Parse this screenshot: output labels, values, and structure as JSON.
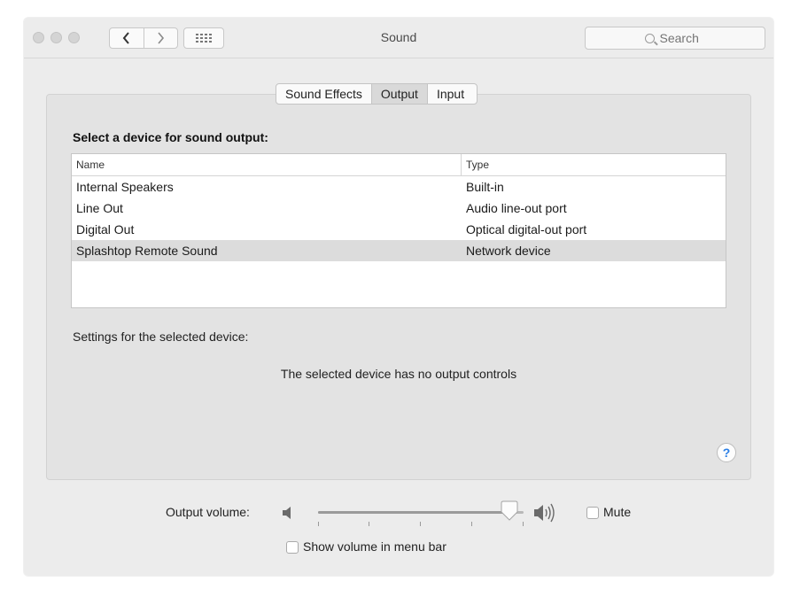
{
  "window": {
    "title": "Sound",
    "search_placeholder": "Search"
  },
  "toolbar": {
    "back_icon": "chevron-left-icon",
    "forward_icon": "chevron-right-icon",
    "show_all_icon": "grid-icon"
  },
  "tabs": [
    {
      "label": "Sound Effects",
      "active": false
    },
    {
      "label": "Output",
      "active": true
    },
    {
      "label": "Input",
      "active": false
    }
  ],
  "output": {
    "section_title": "Select a device for sound output:",
    "columns": [
      "Name",
      "Type"
    ],
    "devices": [
      {
        "name": "Internal Speakers",
        "type": "Built-in",
        "selected": false
      },
      {
        "name": "Line Out",
        "type": "Audio line-out port",
        "selected": false
      },
      {
        "name": "Digital Out",
        "type": "Optical digital-out port",
        "selected": false
      },
      {
        "name": "Splashtop Remote Sound",
        "type": "Network device",
        "selected": true
      }
    ],
    "settings_label": "Settings for the selected device:",
    "no_controls_text": "The selected device has no output controls"
  },
  "help": {
    "label": "?"
  },
  "volume": {
    "label": "Output volume:",
    "level": 0.93,
    "mute_label": "Mute",
    "mute_checked": false,
    "show_in_menu_bar_label": "Show volume in menu bar",
    "show_in_menu_bar_checked": false
  },
  "colors": {
    "accent": "#2b7fe6",
    "selected_row": "#dcdcdc"
  }
}
